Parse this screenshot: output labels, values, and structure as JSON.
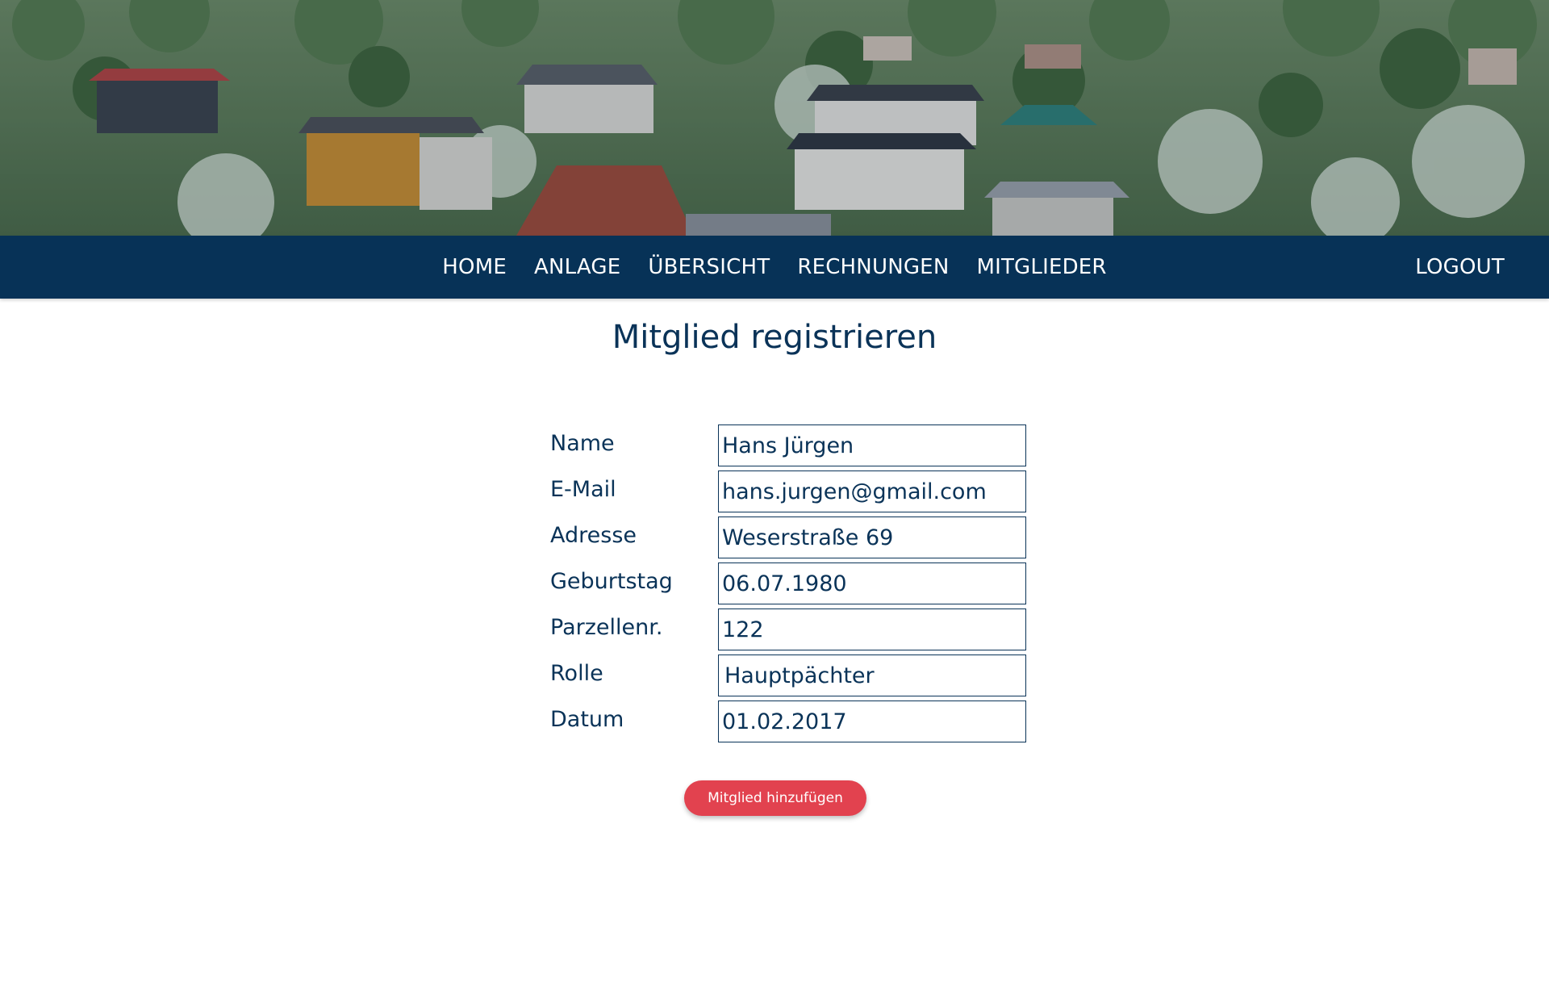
{
  "nav": {
    "items": [
      "HOME",
      "ANLAGE",
      "ÜBERSICHT",
      "RECHNUNGEN",
      "MITGLIEDER"
    ],
    "logout_label": "LOGOUT"
  },
  "page": {
    "title": "Mitglied registrieren"
  },
  "form": {
    "fields": [
      {
        "label": "Name",
        "value": "Hans Jürgen"
      },
      {
        "label": "E-Mail",
        "value": "hans.jurgen@gmail.com"
      },
      {
        "label": "Adresse",
        "value": "Weserstraße 69"
      },
      {
        "label": "Geburtstag",
        "value": "06.07.1980"
      },
      {
        "label": "Parzellenr.",
        "value": "122"
      },
      {
        "label": "Rolle",
        "value": "Hauptpächter"
      },
      {
        "label": "Datum",
        "value": "01.02.2017"
      }
    ],
    "submit_label": "Mitglied hinzufügen"
  },
  "colors": {
    "navbar": "#073257",
    "text_primary": "#0a3358",
    "button_accent": "#e2424f",
    "background": "#ffffff"
  },
  "hero": {
    "image": "allotment-garden-photo"
  }
}
